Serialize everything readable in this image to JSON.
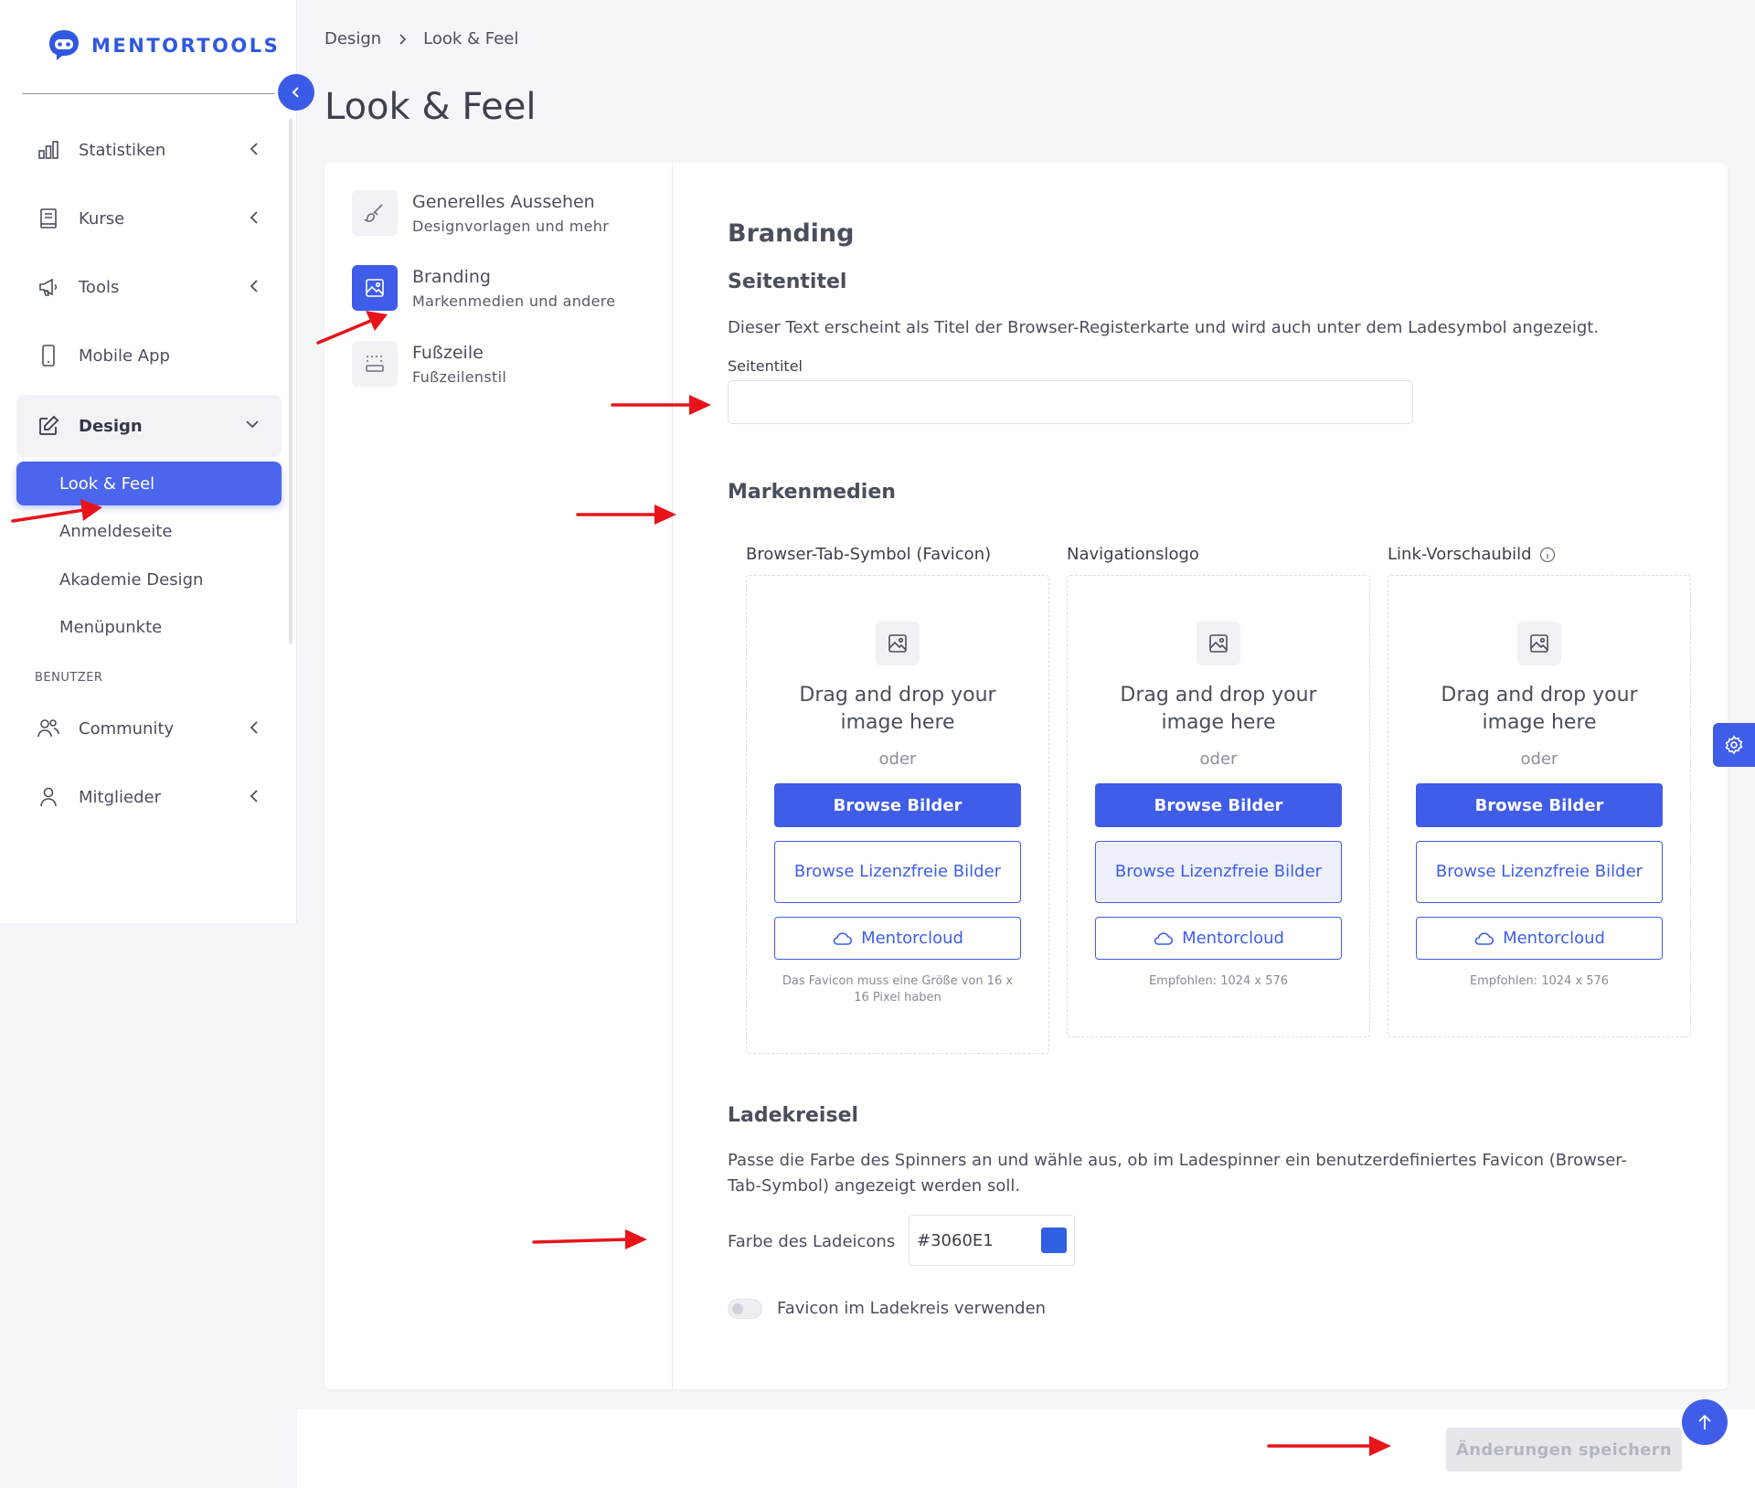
{
  "brand": {
    "name": "MENTORTOOLS"
  },
  "sidebar": {
    "items": [
      {
        "label": "Statistiken",
        "icon": "bar-chart-icon"
      },
      {
        "label": "Kurse",
        "icon": "book-icon"
      },
      {
        "label": "Tools",
        "icon": "megaphone-icon"
      },
      {
        "label": "Mobile App",
        "icon": "smartphone-icon"
      },
      {
        "label": "Design",
        "icon": "edit-icon"
      }
    ],
    "design_children": [
      {
        "label": "Look & Feel",
        "active": true
      },
      {
        "label": "Anmeldeseite"
      },
      {
        "label": "Akademie Design"
      },
      {
        "label": "Menüpunkte"
      }
    ],
    "section_label": "BENUTZER",
    "user_items": [
      {
        "label": "Community",
        "icon": "users-icon"
      },
      {
        "label": "Mitglieder",
        "icon": "user-icon"
      }
    ]
  },
  "breadcrumb": {
    "parent": "Design",
    "current": "Look & Feel"
  },
  "page_title": "Look & Feel",
  "settings_menu": [
    {
      "title": "Generelles Aussehen",
      "subtitle": "Designvorlagen und mehr",
      "icon": "brush-icon"
    },
    {
      "title": "Branding",
      "subtitle": "Markenmedien und andere",
      "icon": "image-icon",
      "active": true
    },
    {
      "title": "Fußzeile",
      "subtitle": "Fußzeilenstil",
      "icon": "footer-icon"
    }
  ],
  "branding": {
    "heading": "Branding",
    "seitentitel_heading": "Seitentitel",
    "seitentitel_desc": "Dieser Text erscheint als Titel der Browser-Registerkarte und wird auch unter dem Ladesymbol angezeigt.",
    "seitentitel_label": "Seitentitel",
    "seitentitel_value": "",
    "markenmedien_heading": "Markenmedien",
    "media": [
      {
        "label": "Browser-Tab-Symbol (Favicon)",
        "drop_text": "Drag and drop your image here",
        "oder": "oder",
        "browse": "Browse Bilder",
        "browse_free": "Browse Lizenzfreie Bilder",
        "cloud": "Mentorcloud",
        "hint": "Das Favicon muss eine Größe von 16 x 16 Pixel haben"
      },
      {
        "label": "Navigationslogo",
        "drop_text": "Drag and drop your image here",
        "oder": "oder",
        "browse": "Browse Bilder",
        "browse_free": "Browse Lizenzfreie Bilder",
        "cloud": "Mentorcloud",
        "hint": "Empfohlen: 1024 x 576"
      },
      {
        "label": "Link-Vorschaubild",
        "drop_text": "Drag and drop your image here",
        "oder": "oder",
        "browse": "Browse Bilder",
        "browse_free": "Browse Lizenzfreie Bilder",
        "cloud": "Mentorcloud",
        "hint": "Empfohlen: 1024 x 576"
      }
    ],
    "ladekreisel_heading": "Ladekreisel",
    "ladekreisel_desc": "Passe die Farbe des Spinners an und wähle aus, ob im Ladespinner ein benutzerdefiniertes Favicon (Browser-Tab-Symbol) angezeigt werden soll.",
    "color_label": "Farbe des Ladeicons",
    "color_value": "#3060E1",
    "favicon_toggle_label": "Favicon im Ladekreis verwenden",
    "favicon_toggle_on": false
  },
  "save_button": "Änderungen speichern",
  "colors": {
    "accent": "#3f5de9",
    "annotation": "#e8141a",
    "spinner": "#3060E1"
  }
}
